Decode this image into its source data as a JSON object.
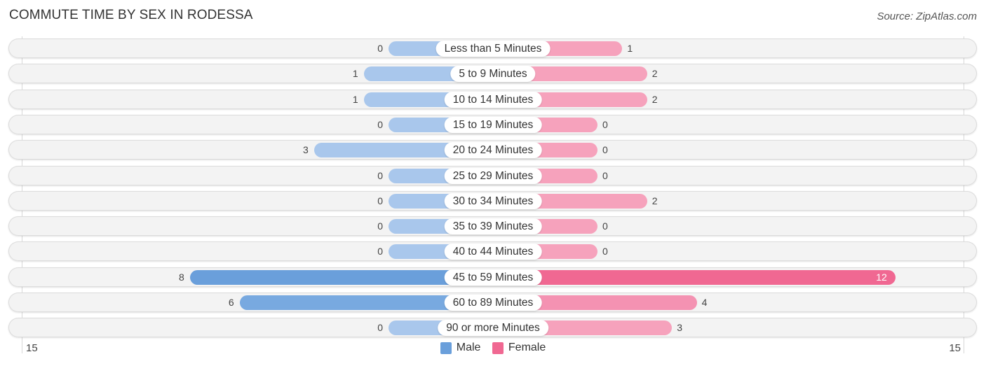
{
  "header": {
    "title": "COMMUTE TIME BY SEX IN RODESSA",
    "source": "Source: ZipAtlas.com"
  },
  "colors": {
    "male": "#a9c7ec",
    "male_strong": "#6a9fdb",
    "female": "#f6a2bc",
    "female_strong": "#f06892"
  },
  "chart_data": {
    "type": "bar",
    "orientation": "horizontal-diverging",
    "title": "COMMUTE TIME BY SEX IN RODESSA",
    "categories": [
      "Less than 5 Minutes",
      "5 to 9 Minutes",
      "10 to 14 Minutes",
      "15 to 19 Minutes",
      "20 to 24 Minutes",
      "25 to 29 Minutes",
      "30 to 34 Minutes",
      "35 to 39 Minutes",
      "40 to 44 Minutes",
      "45 to 59 Minutes",
      "60 to 89 Minutes",
      "90 or more Minutes"
    ],
    "series": [
      {
        "name": "Male",
        "values": [
          0,
          1,
          1,
          0,
          3,
          0,
          0,
          0,
          0,
          8,
          6,
          0
        ]
      },
      {
        "name": "Female",
        "values": [
          1,
          2,
          2,
          0,
          0,
          0,
          2,
          0,
          0,
          12,
          4,
          3
        ]
      }
    ],
    "axis": {
      "left_max_label": "15",
      "right_max_label": "15",
      "max": 15
    },
    "legend": {
      "position": "bottom-center",
      "items": [
        "Male",
        "Female"
      ]
    },
    "grid": false
  }
}
